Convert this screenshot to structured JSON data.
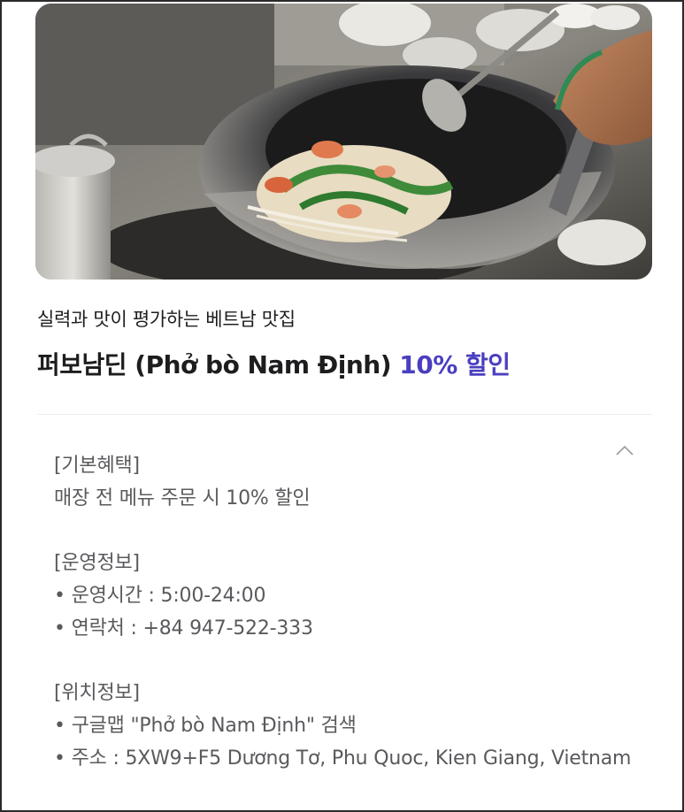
{
  "hero": {
    "image_alt": "wok stir-frying vegetables"
  },
  "card": {
    "subtitle": "실력과 맛이 평가하는 베트남 맛집",
    "title_name": "퍼보남딘 (Phở bò Nam Định) ",
    "title_discount": "10% 할인",
    "discount_color": "#4a3fbf"
  },
  "details": {
    "collapse_icon": "chevron-up-icon",
    "basic_benefit_heading": "[기본혜택]",
    "basic_benefit_text": "매장 전 메뉴 주문 시 10% 할인",
    "operation_heading": "[운영정보]",
    "hours": "• 운영시간 : 5:00-24:00",
    "contact": "• 연락처 : +84 947-522-333",
    "location_heading": "[위치정보]",
    "map_search": "• 구글맵 \"Phở bò Nam Định\" 검색",
    "address": "• 주소 : 5XW9+F5 Dương Tơ, Phu Quoc, Kien Giang, Vietnam"
  }
}
